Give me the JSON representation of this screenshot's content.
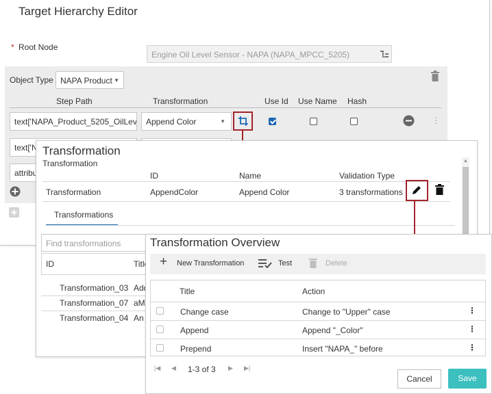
{
  "editor": {
    "title": "Target Hierarchy Editor",
    "root_node_required": "*",
    "root_node_label": "Root Node",
    "root_node_value": "Engine Oil Level Sensor - NAPA (NAPA_MPCC_5205)",
    "object_type_label": "Object Type",
    "object_type_value": "NAPA Product",
    "columns": [
      "Step Path",
      "Transformation",
      "Use Id",
      "Use Name",
      "Hash"
    ],
    "row1": {
      "step_path": "text['NAPA_Product_5205_OilLeve",
      "transformation": "Append Color"
    },
    "row2_step_path": "text['N",
    "row3_step_path": "attribu"
  },
  "transform_dialog": {
    "title": "Transformation",
    "subtitle": "Transformation",
    "headers": {
      "id": "ID",
      "name": "Name",
      "validation": "Validation Type"
    },
    "row": {
      "label": "Transformation",
      "id": "AppendColor",
      "name": "Append Color",
      "validation": "3 transformations"
    },
    "tab": "Transformations",
    "search_placeholder": "Find transformations",
    "list_headers": {
      "id": "ID",
      "title": "Title"
    },
    "list": [
      {
        "id": "Transformation_03",
        "title": "Add"
      },
      {
        "id": "Transformation_07",
        "title": "aM"
      },
      {
        "id": "Transformation_04",
        "title": "An"
      }
    ]
  },
  "overview": {
    "title": "Transformation Overview",
    "toolbar": {
      "new": "New Transformation",
      "test": "Test",
      "delete": "Delete"
    },
    "headers": {
      "title": "Title",
      "action": "Action"
    },
    "rows": [
      {
        "title": "Change case",
        "action": "Change to \"Upper\" case"
      },
      {
        "title": "Append",
        "action": "Append \"_Color\""
      },
      {
        "title": "Prepend",
        "action": "Insert \"NAPA_\" before"
      }
    ],
    "pagination": "1-3 of 3",
    "cancel": "Cancel",
    "save": "Save"
  },
  "colors": {
    "accent": "#1b67b5",
    "highlight": "#a4232a",
    "save": "#3bbfbf"
  }
}
